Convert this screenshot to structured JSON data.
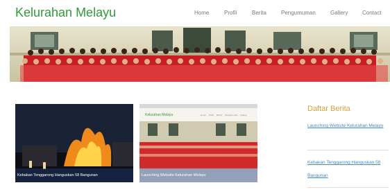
{
  "header": {
    "logo": "Kelurahan Melayu",
    "nav": [
      "Home",
      "Profil",
      "Berita",
      "Pengumuman",
      "Gallery",
      "Contact"
    ]
  },
  "hero": {
    "alt": "Foto bersama warga Kelurahan Melayu berpakaian merah"
  },
  "news_cards": [
    {
      "caption": "Kebakan Tenggarong Hanguskan 58 Bangunan"
    },
    {
      "caption": "Launching Website Kelurahan Melayu"
    }
  ],
  "card2_preview": {
    "logo": "Kelurahan Melayu",
    "nav": [
      "Home",
      "Profil",
      "Berita",
      "Pengumuman",
      "Gallery"
    ]
  },
  "sidebar": {
    "title": "Daftar Berita",
    "links": [
      "Launching Website Kelurahan Melayu",
      "Kebakan Tenggarong Hanguskan 58 Bangunan"
    ]
  },
  "colors": {
    "brand_green": "#2e9a3a",
    "sidebar_title": "#d9a03a",
    "link_blue": "#4a86c5",
    "nav_gray": "#7a7a7a"
  }
}
